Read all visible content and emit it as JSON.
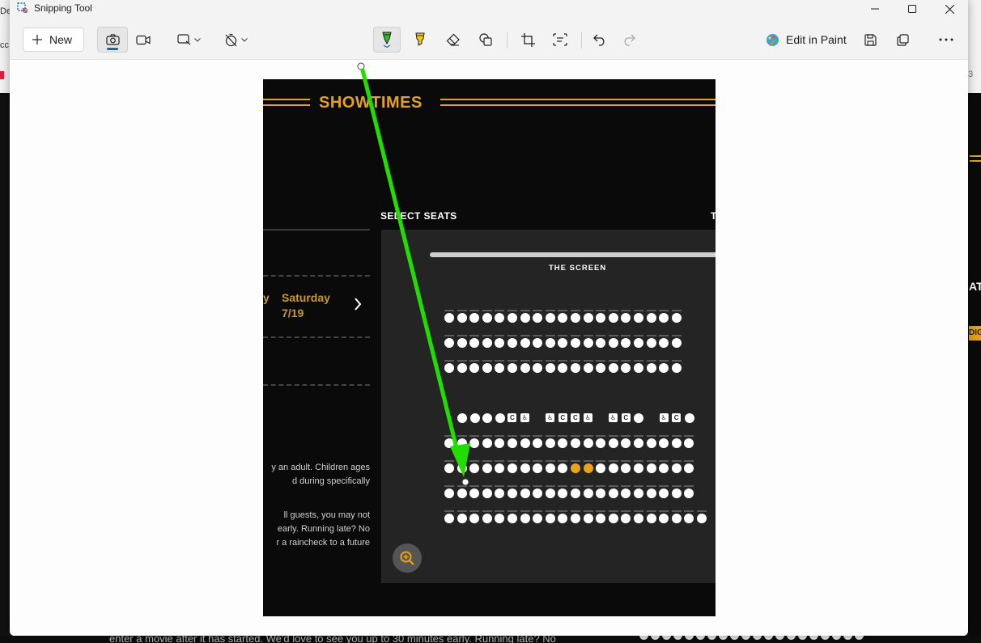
{
  "background_app": {
    "left_text_1": "De",
    "left_text_2": "cc",
    "right_text_1": "3",
    "right_heading_stub": "AT",
    "right_badge_stub": "DIG",
    "bottom_text": "enter a movie after it has started. We'd love to see you up to 30 minutes early. Running late? No"
  },
  "window": {
    "title": "Snipping Tool",
    "minimize_icon": "minimize-icon",
    "maximize_icon": "maximize-icon",
    "close_icon": "close-icon"
  },
  "toolbar": {
    "new_label": "New",
    "edit_in_paint_label": "Edit in Paint",
    "active_mode": "screenshot",
    "pen_color": "#2db82d",
    "highlighter_color": "#f2c811"
  },
  "capture": {
    "heading": "SHOWTIMES",
    "select_seats_label": "SELECT SEATS",
    "right_stub": "T",
    "day_stub": "y",
    "day_name": "Saturday",
    "day_date": "7/19",
    "screen_label": "THE SCREEN",
    "fine_print_1": [
      "y an adult. Children ages",
      "d during specifically"
    ],
    "fine_print_2": [
      "ll guests, you may not",
      "early. Running late? No",
      "r a raincheck to a future"
    ],
    "colors": {
      "accent": "#e2a21f",
      "selected_seat": "#e8a21d",
      "panel": "#242424"
    },
    "seat_rows": [
      {
        "type": "regular",
        "count": 19,
        "selected": []
      },
      {
        "type": "regular",
        "count": 19,
        "selected": []
      },
      {
        "type": "regular",
        "count": 19,
        "selected": []
      },
      {
        "type": "accessible",
        "layout": [
          "o",
          "o",
          "o",
          "o",
          "C",
          "W",
          "_",
          "W",
          "C",
          "C",
          "W",
          "_",
          "W",
          "C",
          "o",
          "_",
          "W",
          "C",
          "o"
        ]
      },
      {
        "type": "regular",
        "count": 20,
        "selected": []
      },
      {
        "type": "regular",
        "count": 20,
        "selected": [
          10,
          11
        ]
      },
      {
        "type": "regular",
        "count": 20,
        "selected": []
      },
      {
        "type": "regular",
        "count": 21,
        "selected": []
      }
    ]
  },
  "annotation": {
    "color": "#22dd00",
    "kind": "arrow"
  }
}
